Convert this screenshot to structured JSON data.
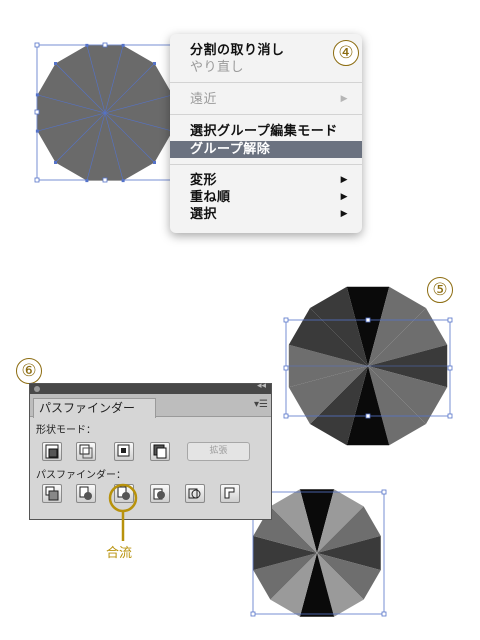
{
  "context_menu": {
    "items": [
      {
        "label": "分割の取り消し",
        "enabled": true
      },
      {
        "label": "やり直し",
        "enabled": false
      },
      {
        "label": "遠近",
        "enabled": false,
        "submenu": true
      },
      {
        "label": "選択グループ編集モード",
        "enabled": true
      },
      {
        "label": "グループ解除",
        "enabled": true,
        "highlighted": true
      },
      {
        "label": "変形",
        "enabled": true,
        "submenu": true
      },
      {
        "label": "重ね順",
        "enabled": true,
        "submenu": true
      },
      {
        "label": "選択",
        "enabled": true,
        "submenu": true
      }
    ]
  },
  "steps": {
    "step4": "④",
    "step5": "⑤",
    "step6": "⑥"
  },
  "panel": {
    "tab_label": "パスファインダー",
    "shape_mode_label": "形状モード：",
    "expand_label": "拡張",
    "pathfinder_label": "パスファインダー：",
    "menu_icon": "menu-icon",
    "shape_mode_buttons": [
      "unite-icon",
      "minus-front-icon",
      "intersect-icon",
      "exclude-icon"
    ],
    "pathfinder_buttons": [
      "divide-icon",
      "trim-icon",
      "merge-icon",
      "crop-icon",
      "outline-icon",
      "minus-back-icon"
    ]
  },
  "annotation": {
    "merge_label": "合流",
    "highlight_color": "#b8920c"
  },
  "colors": {
    "shape_fill": "#6a6a6a",
    "selection": "#5573c9",
    "menu_highlight": "#6b7280"
  }
}
